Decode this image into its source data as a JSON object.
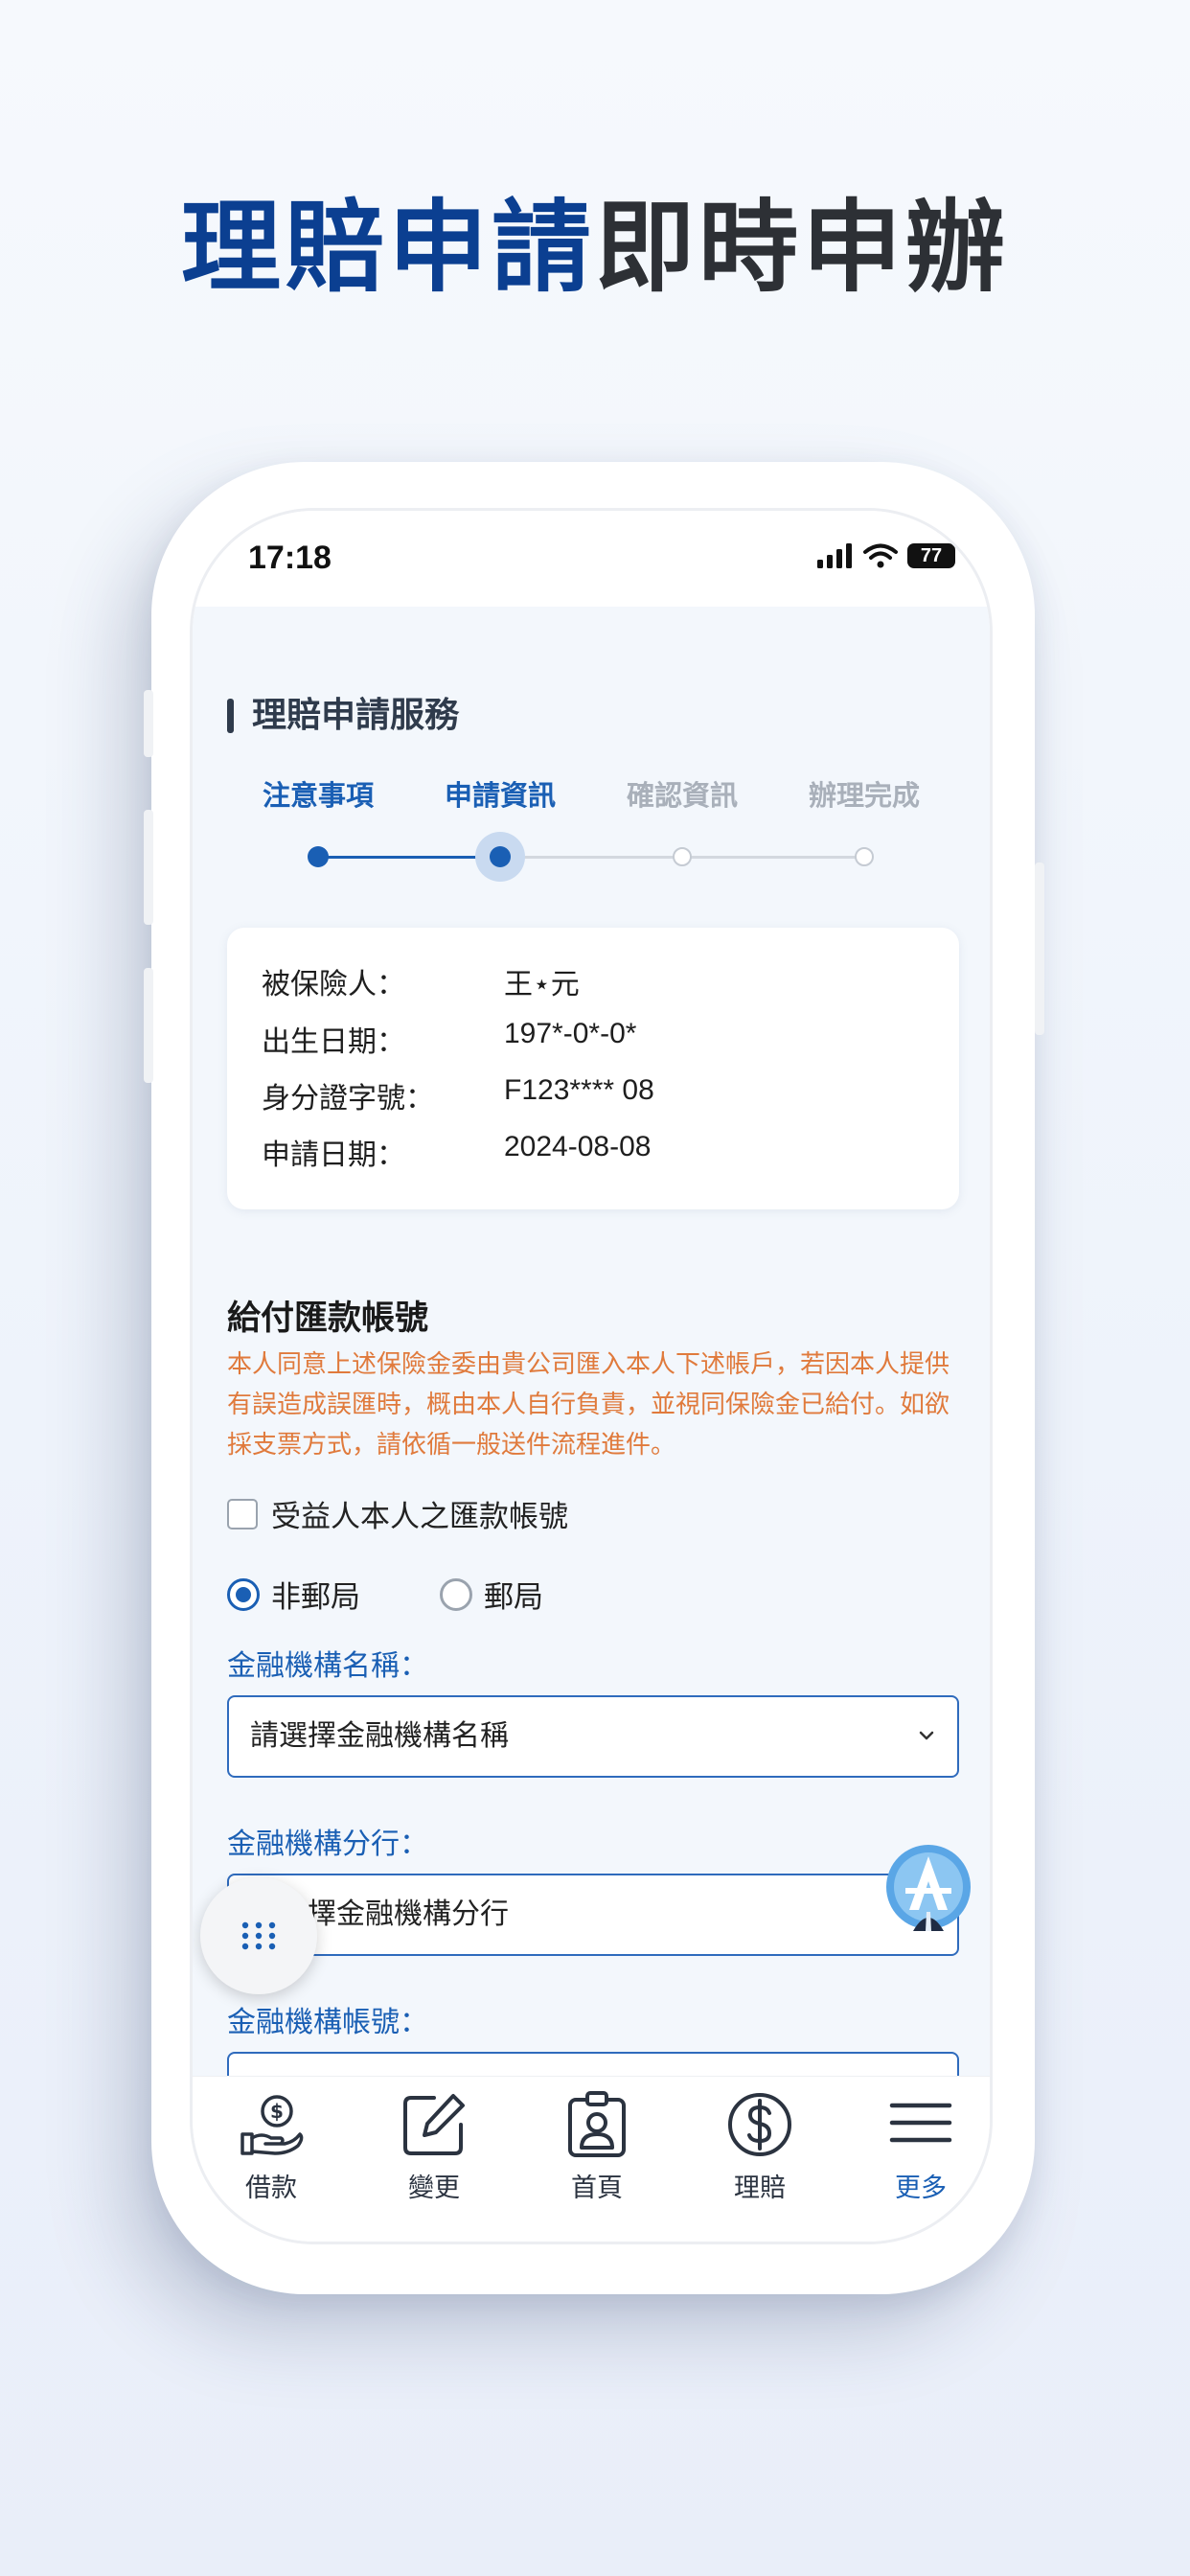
{
  "headline": {
    "part_blue": "理賠申請",
    "part_dark": "即時申辦"
  },
  "status_bar": {
    "time": "17:18",
    "battery": "77"
  },
  "page": {
    "section_title": "理賠申請服務"
  },
  "steps": [
    {
      "label": "注意事項",
      "state": "done"
    },
    {
      "label": "申請資訊",
      "state": "current"
    },
    {
      "label": "確認資訊",
      "state": "todo"
    },
    {
      "label": "辦理完成",
      "state": "todo"
    }
  ],
  "info": {
    "rows": [
      {
        "key": "被保險人：",
        "value": "王⋆元"
      },
      {
        "key": "出生日期：",
        "value": "197*-0*-0*"
      },
      {
        "key": "身分證字號：",
        "value": "F123**** 08"
      },
      {
        "key": "申請日期：",
        "value": "2024-08-08"
      }
    ]
  },
  "payment": {
    "title": "給付匯款帳號",
    "notice": "本人同意上述保險金委由貴公司匯入本人下述帳戶，若因本人提供有誤造成誤匯時，概由本人自行負責，並視同保險金已給付。如欲採支票方式，請依循一般送件流程進件。",
    "checkbox_label": "受益人本人之匯款帳號",
    "radio_non_post": "非郵局",
    "radio_post": "郵局",
    "institution_label": "金融機構名稱：",
    "institution_placeholder": "請選擇金融機構名稱",
    "branch_label": "金融機構分行：",
    "branch_placeholder": "請選擇金融機構分行",
    "account_label": "金融機構帳號："
  },
  "tabs": [
    {
      "label": "借款",
      "icon": "loan-hand-coin-icon"
    },
    {
      "label": "變更",
      "icon": "edit-icon"
    },
    {
      "label": "首頁",
      "icon": "id-badge-icon"
    },
    {
      "label": "理賠",
      "icon": "dollar-circle-icon"
    },
    {
      "label": "更多",
      "icon": "menu-icon",
      "active": true
    }
  ],
  "colors": {
    "brand_blue": "#1a5fb4",
    "headline_blue": "#0b3f91",
    "notice_orange": "#e07a3c"
  }
}
